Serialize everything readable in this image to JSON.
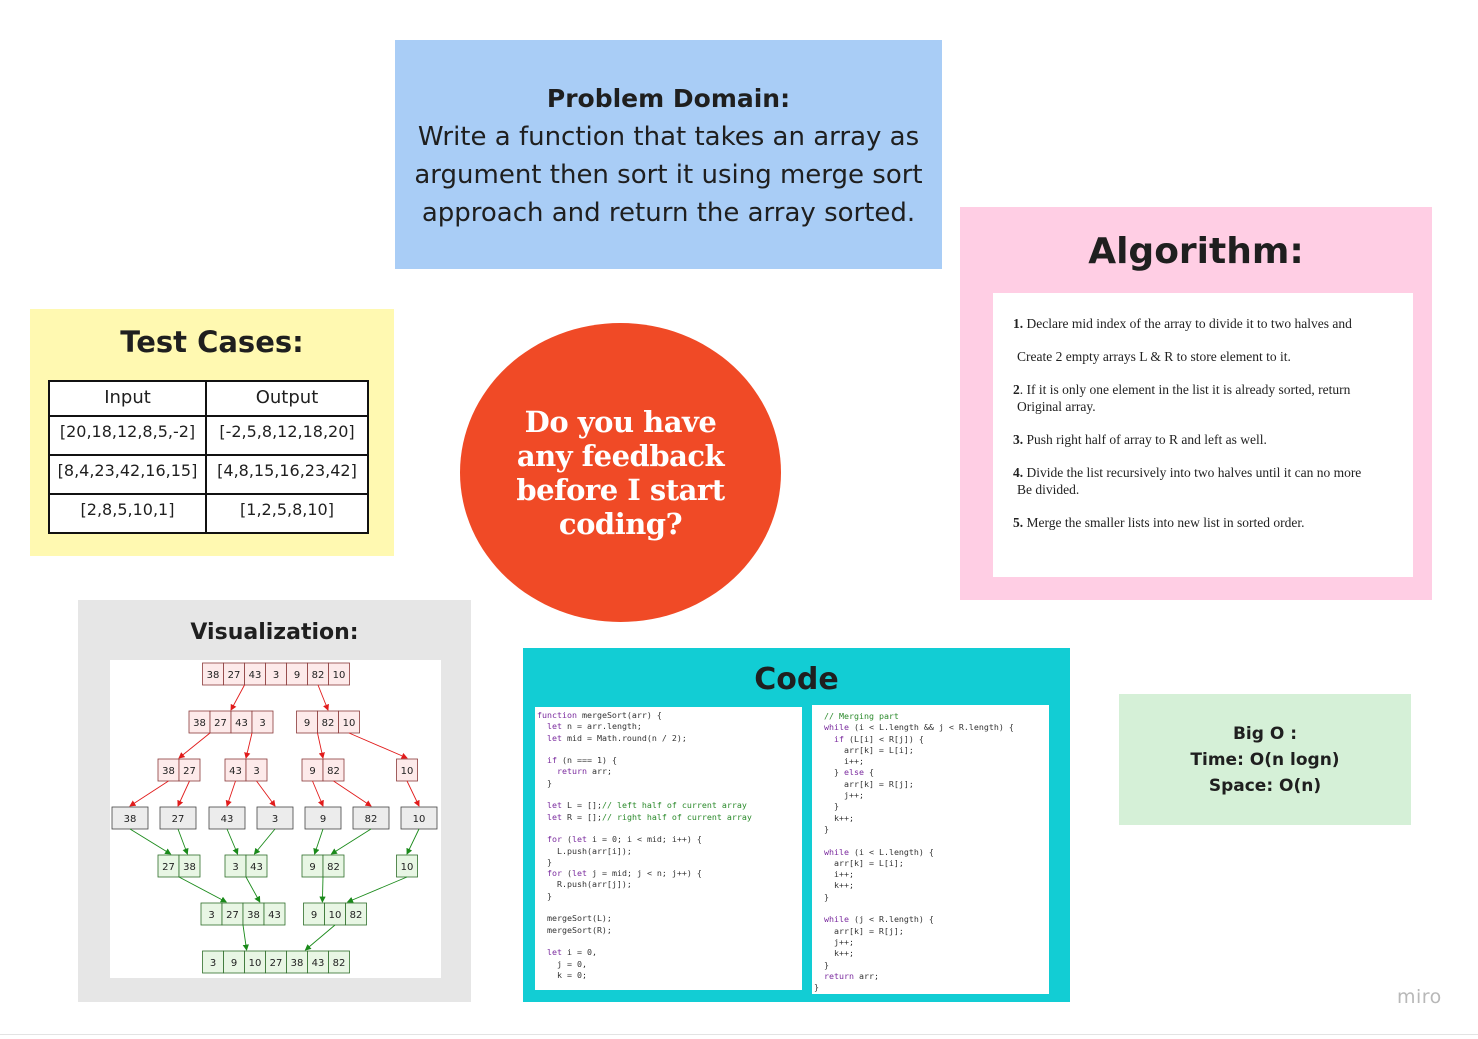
{
  "problem": {
    "title": "Problem Domain:",
    "body": "Write a function that takes an array as argument then sort it using merge sort approach and return the array sorted."
  },
  "algorithm": {
    "title": "Algorithm:",
    "steps": [
      {
        "num": "1.",
        "line1": " Declare mid index of the array to divide it to two halves and",
        "line2": "Create 2 empty arrays L & R to store element to it."
      },
      {
        "num": "2",
        "line1": ". If it is only one element in the list it is already sorted, return",
        "line2": "Original array."
      },
      {
        "num": "3.",
        "line1": " Push right half of array to R and left as well.",
        "line2": ""
      },
      {
        "num": "4.",
        "line1": " Divide the list recursively into two halves until it can no more",
        "line2": "Be divided."
      },
      {
        "num": "5.",
        "line1": " Merge the smaller lists into new list in sorted order.",
        "line2": ""
      }
    ]
  },
  "tests": {
    "title": "Test Cases:",
    "headers": [
      "Input",
      "Output"
    ],
    "rows": [
      [
        "[20,18,12,8,5,-2]",
        "[-2,5,8,12,18,20]"
      ],
      [
        "[8,4,23,42,16,15]",
        "[4,8,15,16,23,42]"
      ],
      [
        "[2,8,5,10,1]",
        "[1,2,5,8,10]"
      ]
    ]
  },
  "feedback": {
    "text": "Do you have any feedback before I start coding?"
  },
  "visualization": {
    "title": "Visualization:",
    "levels": [
      {
        "kind": "split",
        "groups": [
          [
            "38",
            "27",
            "43",
            "3",
            "9",
            "82",
            "10"
          ]
        ]
      },
      {
        "kind": "split",
        "groups": [
          [
            "38",
            "27",
            "43",
            "3"
          ],
          [
            "9",
            "82",
            "10"
          ]
        ]
      },
      {
        "kind": "split",
        "groups": [
          [
            "38",
            "27"
          ],
          [
            "43",
            "3"
          ],
          [
            "9",
            "82"
          ],
          [
            "10"
          ]
        ]
      },
      {
        "kind": "single",
        "groups": [
          [
            "38"
          ],
          [
            "27"
          ],
          [
            "43"
          ],
          [
            "3"
          ],
          [
            "9"
          ],
          [
            "82"
          ],
          [
            "10"
          ]
        ]
      },
      {
        "kind": "merge",
        "groups": [
          [
            "27",
            "38"
          ],
          [
            "3",
            "43"
          ],
          [
            "9",
            "82"
          ],
          [
            "10"
          ]
        ]
      },
      {
        "kind": "merge",
        "groups": [
          [
            "3",
            "27",
            "38",
            "43"
          ],
          [
            "9",
            "10",
            "82"
          ]
        ]
      },
      {
        "kind": "merge",
        "groups": [
          [
            "3",
            "9",
            "10",
            "27",
            "38",
            "43",
            "82"
          ]
        ]
      }
    ],
    "colors": {
      "split_fill": "#fdeaea",
      "split_stroke": "#8a3a3a",
      "split_arrow": "#e11b1b",
      "single_fill": "#ececec",
      "single_stroke": "#444444",
      "merge_fill": "#e8f6e4",
      "merge_stroke": "#2f6e2a",
      "merge_arrow": "#1a8a1a"
    }
  },
  "code": {
    "title": "Code",
    "left": [
      [
        [
          "k",
          "function"
        ],
        [
          "t",
          " mergeSort(arr) {"
        ]
      ],
      [
        [
          "t",
          "  "
        ],
        [
          "k",
          "let"
        ],
        [
          "t",
          " n = arr.length;"
        ]
      ],
      [
        [
          "t",
          "  "
        ],
        [
          "k",
          "let"
        ],
        [
          "t",
          " mid = Math.round(n / 2);"
        ]
      ],
      [
        [
          "t",
          ""
        ]
      ],
      [
        [
          "t",
          "  "
        ],
        [
          "k",
          "if"
        ],
        [
          "t",
          " (n === 1) {"
        ]
      ],
      [
        [
          "t",
          "    "
        ],
        [
          "k",
          "return"
        ],
        [
          "t",
          " arr;"
        ]
      ],
      [
        [
          "t",
          "  }"
        ]
      ],
      [
        [
          "t",
          ""
        ]
      ],
      [
        [
          "t",
          "  "
        ],
        [
          "k",
          "let"
        ],
        [
          "t",
          " L = [];"
        ],
        [
          "c",
          "// left half of current array"
        ]
      ],
      [
        [
          "t",
          "  "
        ],
        [
          "k",
          "let"
        ],
        [
          "t",
          " R = [];"
        ],
        [
          "c",
          "// right half of current array"
        ]
      ],
      [
        [
          "t",
          ""
        ]
      ],
      [
        [
          "t",
          "  "
        ],
        [
          "k",
          "for"
        ],
        [
          "t",
          " ("
        ],
        [
          "k",
          "let"
        ],
        [
          "t",
          " i = 0; i < mid; i++) {"
        ]
      ],
      [
        [
          "t",
          "    L.push(arr[i]);"
        ]
      ],
      [
        [
          "t",
          "  }"
        ]
      ],
      [
        [
          "t",
          "  "
        ],
        [
          "k",
          "for"
        ],
        [
          "t",
          " ("
        ],
        [
          "k",
          "let"
        ],
        [
          "t",
          " j = mid; j < n; j++) {"
        ]
      ],
      [
        [
          "t",
          "    R.push(arr[j]);"
        ]
      ],
      [
        [
          "t",
          "  }"
        ]
      ],
      [
        [
          "t",
          ""
        ]
      ],
      [
        [
          "t",
          "  mergeSort(L);"
        ]
      ],
      [
        [
          "t",
          "  mergeSort(R);"
        ]
      ],
      [
        [
          "t",
          ""
        ]
      ],
      [
        [
          "t",
          "  "
        ],
        [
          "k",
          "let"
        ],
        [
          "t",
          " i = 0,"
        ]
      ],
      [
        [
          "t",
          "    j = 0,"
        ]
      ],
      [
        [
          "t",
          "    k = 0;"
        ]
      ]
    ],
    "right": [
      [
        [
          "t",
          "  "
        ],
        [
          "c",
          "// Merging part"
        ]
      ],
      [
        [
          "t",
          "  "
        ],
        [
          "k",
          "while"
        ],
        [
          "t",
          " (i < L.length && j < R.length) {"
        ]
      ],
      [
        [
          "t",
          "    "
        ],
        [
          "k",
          "if"
        ],
        [
          "t",
          " (L[i] < R[j]) {"
        ]
      ],
      [
        [
          "t",
          "      arr[k] = L[i];"
        ]
      ],
      [
        [
          "t",
          "      i++;"
        ]
      ],
      [
        [
          "t",
          "    } "
        ],
        [
          "k",
          "else"
        ],
        [
          "t",
          " {"
        ]
      ],
      [
        [
          "t",
          "      arr[k] = R[j];"
        ]
      ],
      [
        [
          "t",
          "      j++;"
        ]
      ],
      [
        [
          "t",
          "    }"
        ]
      ],
      [
        [
          "t",
          "    k++;"
        ]
      ],
      [
        [
          "t",
          "  }"
        ]
      ],
      [
        [
          "t",
          ""
        ]
      ],
      [
        [
          "t",
          "  "
        ],
        [
          "k",
          "while"
        ],
        [
          "t",
          " (i < L.length) {"
        ]
      ],
      [
        [
          "t",
          "    arr[k] = L[i];"
        ]
      ],
      [
        [
          "t",
          "    i++;"
        ]
      ],
      [
        [
          "t",
          "    k++;"
        ]
      ],
      [
        [
          "t",
          "  }"
        ]
      ],
      [
        [
          "t",
          ""
        ]
      ],
      [
        [
          "t",
          "  "
        ],
        [
          "k",
          "while"
        ],
        [
          "t",
          " (j < R.length) {"
        ]
      ],
      [
        [
          "t",
          "    arr[k] = R[j];"
        ]
      ],
      [
        [
          "t",
          "    j++;"
        ]
      ],
      [
        [
          "t",
          "    k++;"
        ]
      ],
      [
        [
          "t",
          "  }"
        ]
      ],
      [
        [
          "t",
          "  "
        ],
        [
          "k",
          "return"
        ],
        [
          "t",
          " arr;"
        ]
      ],
      [
        [
          "t",
          "}"
        ]
      ]
    ],
    "colors": {
      "keyword": "#7a2a9e",
      "comment": "#2b8a2b",
      "text": "#333333"
    }
  },
  "bigo": {
    "heading": "Big O :",
    "time": "Time: O(n logn)",
    "space": "Space: O(n)"
  },
  "watermark": "miro",
  "colors": {
    "problem_bg": "#a9cdf6",
    "algorithm_bg": "#ffcee4",
    "tests_bg": "#fff9b1",
    "feedback_bg": "#f04a26",
    "viz_bg": "#e6e6e6",
    "code_bg": "#12cdd4",
    "bigo_bg": "#d5f0d7"
  }
}
